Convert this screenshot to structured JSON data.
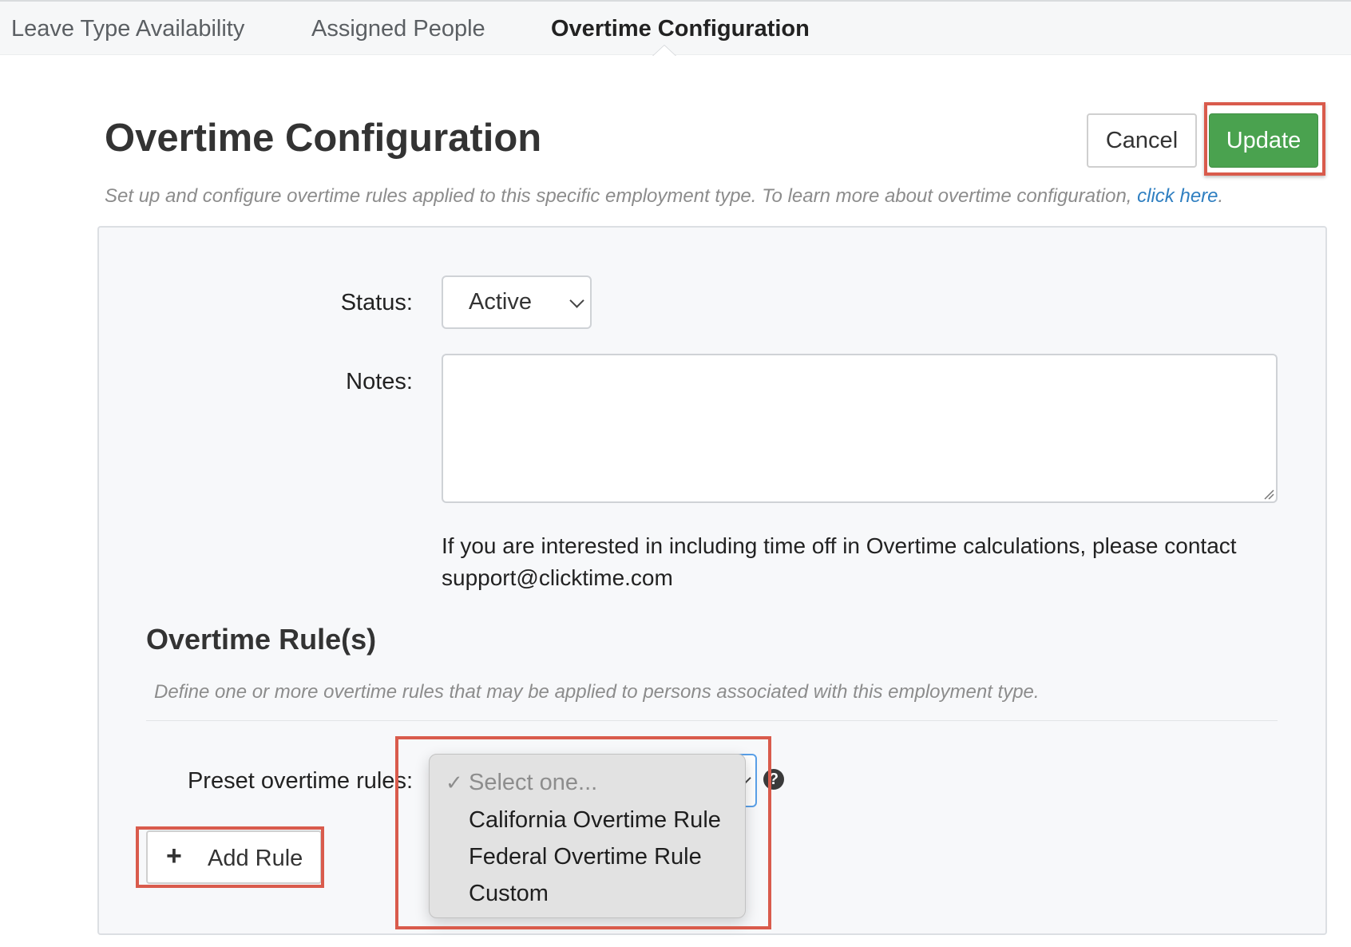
{
  "tabs": [
    {
      "label": "Leave Type Availability"
    },
    {
      "label": "Assigned People"
    },
    {
      "label": "Overtime Configuration",
      "active": true
    }
  ],
  "header": {
    "title": "Overtime Configuration",
    "cancel_label": "Cancel",
    "update_label": "Update",
    "subtitle": "Set up and configure overtime rules applied to this specific employment type. To learn more about overtime configuration, ",
    "subtitle_link": "click here",
    "subtitle_end": "."
  },
  "form": {
    "status_label": "Status:",
    "status_value": "Active",
    "notes_label": "Notes:",
    "notes_value": "",
    "info_text": "If you are interested in including time off in Overtime calculations, please contact support@clicktime.com"
  },
  "rules": {
    "title": "Overtime Rule(s)",
    "description": "Define one or more overtime rules that may be applied to persons associated with this employment type.",
    "preset_label": "Preset overtime rules:",
    "help_icon": "?",
    "dropdown_options": [
      {
        "label": "Select one...",
        "checked": true
      },
      {
        "label": "California Overtime Rule"
      },
      {
        "label": "Federal Overtime Rule"
      },
      {
        "label": "Custom"
      }
    ],
    "add_rule_label": "Add Rule",
    "add_icon": "+"
  },
  "colors": {
    "accent_green": "#4aa24f",
    "highlight_red": "#d95b4c",
    "link_blue": "#2f7fc1",
    "focus_blue": "#5aa0e8"
  },
  "icons": [
    "chevron-down-icon",
    "help-icon",
    "plus-icon",
    "checkmark-icon",
    "resize-grip-icon"
  ]
}
